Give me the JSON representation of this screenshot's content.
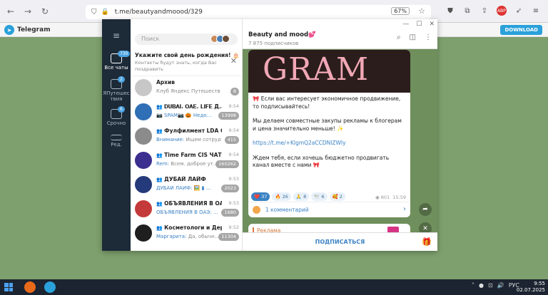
{
  "browser": {
    "url": "t.me/beautyandmoood/329",
    "zoom": "67%"
  },
  "site": {
    "name": "Telegram",
    "download_label": "DOWNLOAD"
  },
  "rail": {
    "items": [
      {
        "label": "Все чаты",
        "badge": "730"
      },
      {
        "label": "ЯПутешествия",
        "badge": "2"
      },
      {
        "label": "Срочно",
        "badge": "6"
      },
      {
        "label": "Ред.",
        "badge": ""
      }
    ]
  },
  "search": {
    "placeholder": "Поиск"
  },
  "birthday": {
    "title": "Укажите свой день рождения! 🎂",
    "subtitle": "Контакты будут знать, когда Вас поздравить"
  },
  "chats": [
    {
      "name": "Архив",
      "time": "",
      "preview": "Клуб Яндекс Путешествен...",
      "accent": "",
      "badge": "8",
      "color": "#c7c7c7"
    },
    {
      "name": "𝐃𝐔𝐁𝐀𝐈. 𝐎𝐀𝐄. 𝐋𝐈𝐅𝐄 Д...",
      "time": "9:54",
      "preview": "📷 SPAM📷 🎃 Недо...",
      "accent": "",
      "badge": "13998",
      "color": "#2f6fb5"
    },
    {
      "name": "Фулфилмент LDA GR...",
      "time": "9:54",
      "preview": "Ищем сотрудников",
      "accent": "Внимание: ",
      "badge": "415",
      "color": "#8b8b8b"
    },
    {
      "name": "Time Farm CIS ЧАТ",
      "time": "9:54",
      "preview": "Всем. доброе ут...",
      "accent": "Rem: ",
      "badge": "160262",
      "color": "#3a2f8f"
    },
    {
      "name": "ДУБАЙ ЛАЙФ",
      "time": "9:53",
      "preview": "ДУБАЙ ЛАЙФ: 🖼️ ▮ ...",
      "accent": "",
      "badge": "2023",
      "color": "#253a7a"
    },
    {
      "name": "ОБЪЯВЛЕНИЯ В ОАЭ",
      "time": "9:53",
      "preview": "ОБЪЯВЛЕНИЯ В ОАЭ: ...",
      "accent": "",
      "badge": "1680",
      "color": "#c43a3a"
    },
    {
      "name": "Косметологи и Дерм...",
      "time": "9:52",
      "preview": "Да, обычн...",
      "accent": "Маргарита: ",
      "badge": "11304",
      "color": "#1f1f1f"
    }
  ],
  "channel": {
    "title": "Beauty and mood💕",
    "subscribers": "7 875 подписчиков"
  },
  "post": {
    "image_text": "GRAM",
    "lines": [
      "🎀 Если вас интересует экономичное продвижение, то подписывайтесь!",
      "Мы делаем совместные закупы рекламы к блогерам и цена значительно меньше! ✨",
      "https://t.me/+KIgmQ2aCCDNlZWIy",
      "Ждем тебя, если хочешь бюджетно продвигать канал вместе с нами 🎀"
    ],
    "reactions": [
      {
        "emoji": "❤️",
        "count": "37"
      },
      {
        "emoji": "🔥",
        "count": "26"
      },
      {
        "emoji": "🙏",
        "count": "8"
      },
      {
        "emoji": "🕊️",
        "count": "6"
      },
      {
        "emoji": "🥰",
        "count": "2"
      }
    ],
    "views": "801",
    "time": "15:59",
    "comments": "1 комментарий"
  },
  "post2": {
    "label": "Реклама"
  },
  "subscribe_label": "ПОДПИСАТЬСЯ",
  "taskbar": {
    "lang": "РУС",
    "time": "9:55",
    "date": "02.07.2025"
  }
}
